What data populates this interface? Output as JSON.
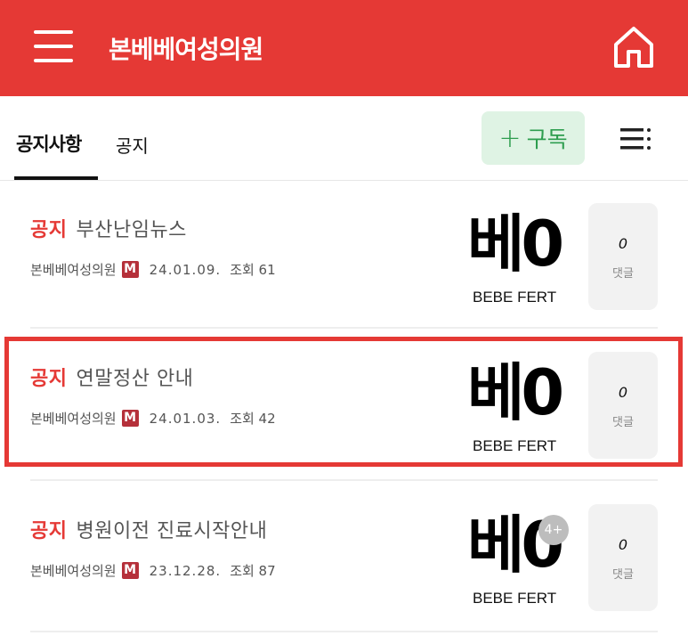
{
  "header": {
    "title": "본베베여성의원",
    "menu_icon": "hamburger-menu-icon",
    "home_icon": "home-icon",
    "bg_color": "#e53935"
  },
  "tabs": {
    "active": "공지사항",
    "second": "공지"
  },
  "actions": {
    "subscribe_plus": "+",
    "subscribe_label": "구독",
    "list_icon": "list-menu-icon"
  },
  "posts": [
    {
      "category": "공지",
      "title": "부산난임뉴스",
      "author": "본베베여성의원",
      "badge": "M",
      "date": "24.01.09.",
      "views_label": "조회 61",
      "thumb_big": "베0",
      "thumb_small": "BEBE FERT",
      "comments": "0",
      "comments_label": "댓글"
    },
    {
      "category": "공지",
      "title": "연말정산 안내",
      "author": "본베베여성의원",
      "badge": "M",
      "date": "24.01.03.",
      "views_label": "조회 42",
      "thumb_big": "베0",
      "thumb_small": "BEBE FERT",
      "comments": "0",
      "comments_label": "댓글"
    },
    {
      "category": "공지",
      "title": "병원이전 진료시작안내",
      "author": "본베베여성의원",
      "badge": "M",
      "date": "23.12.28.",
      "views_label": "조회 87",
      "thumb_big": "베0",
      "thumb_small": "BEBE FERT",
      "thumb_badge": "4+",
      "comments": "0",
      "comments_label": "댓글"
    }
  ]
}
